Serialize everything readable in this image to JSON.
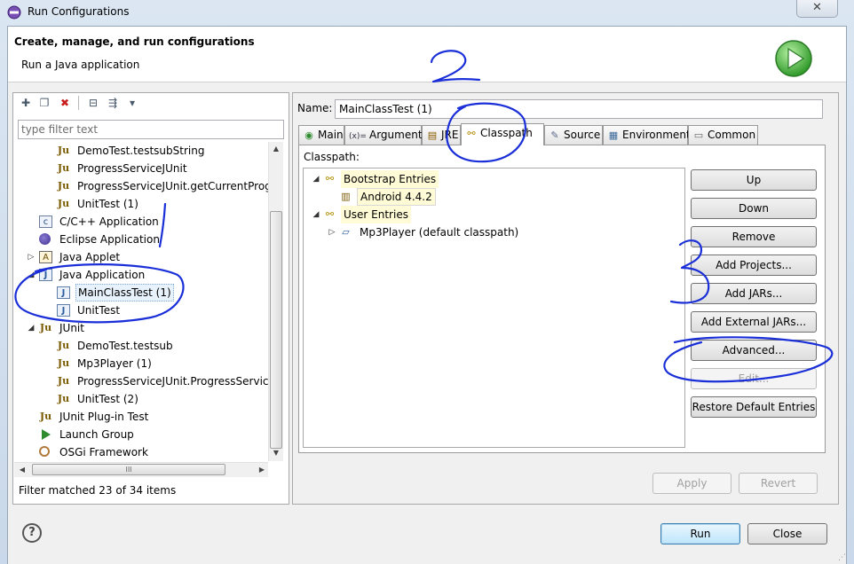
{
  "window": {
    "title": "Run Configurations",
    "close_glyph": "✕",
    "icon": "run-configurations-icon"
  },
  "header": {
    "title": "Create, manage, and run configurations",
    "subtitle": "Run a Java application",
    "icon": "run-play-icon",
    "accent": "#3aa33a"
  },
  "left": {
    "toolbar": [
      {
        "name": "new-configuration-icon",
        "glyph": "✚"
      },
      {
        "name": "duplicate-icon",
        "glyph": "❐"
      },
      {
        "name": "delete-icon",
        "glyph": "✖"
      },
      {
        "name": "collapse-all-icon",
        "glyph": "⊟"
      },
      {
        "name": "filter-icon",
        "glyph": "⇶"
      },
      {
        "name": "view-menu-icon",
        "glyph": "▾"
      }
    ],
    "filter_placeholder": "type filter text",
    "tree": [
      {
        "label": "DemoTest.testsubString",
        "icon": "junit-icon",
        "glyph": "Ju",
        "level": 2
      },
      {
        "label": "ProgressServiceJUnit",
        "icon": "junit-icon",
        "glyph": "Ju",
        "level": 2
      },
      {
        "label": "ProgressServiceJUnit.getCurrentProge",
        "icon": "junit-icon",
        "glyph": "Ju",
        "level": 2
      },
      {
        "label": "UnitTest (1)",
        "icon": "junit-icon",
        "glyph": "Ju",
        "level": 2
      },
      {
        "label": "C/C++ Application",
        "icon": "cpp-application-icon",
        "glyph": "c",
        "level": 1
      },
      {
        "label": "Eclipse Application",
        "icon": "eclipse-application-icon",
        "glyph": "",
        "level": 1
      },
      {
        "label": "Java Applet",
        "icon": "java-applet-icon",
        "glyph": "A",
        "level": 1,
        "twisty": "▷"
      },
      {
        "label": "Java Application",
        "icon": "java-application-icon",
        "glyph": "J",
        "level": 1,
        "twisty": "◢"
      },
      {
        "label": "MainClassTest (1)",
        "icon": "java-application-icon",
        "glyph": "J",
        "level": 2,
        "selected": true
      },
      {
        "label": "UnitTest",
        "icon": "java-application-icon",
        "glyph": "J",
        "level": 2
      },
      {
        "label": "JUnit",
        "icon": "junit-icon",
        "glyph": "Ju",
        "level": 1,
        "twisty": "◢"
      },
      {
        "label": "DemoTest.testsub",
        "icon": "junit-icon",
        "glyph": "Ju",
        "level": 2
      },
      {
        "label": "Mp3Player (1)",
        "icon": "junit-icon",
        "glyph": "Ju",
        "level": 2
      },
      {
        "label": "ProgressServiceJUnit.ProgressServiceJ",
        "icon": "junit-icon",
        "glyph": "Ju",
        "level": 2
      },
      {
        "label": "UnitTest (2)",
        "icon": "junit-icon",
        "glyph": "Ju",
        "level": 2
      },
      {
        "label": "JUnit Plug-in Test",
        "icon": "junit-plugin-icon",
        "glyph": "Ju",
        "level": 1
      },
      {
        "label": "Launch Group",
        "icon": "launch-group-icon",
        "glyph": "",
        "level": 1
      },
      {
        "label": "OSGi Framework",
        "icon": "osgi-framework-icon",
        "glyph": "",
        "level": 1
      }
    ],
    "hscroll_thumb_glyph": "III",
    "status": "Filter matched 23 of 34 items"
  },
  "right": {
    "name_label": "Name:",
    "name_value": "MainClassTest (1)",
    "tabs": [
      {
        "label": "Main",
        "icon": "main-tab-icon",
        "glyph": "◉"
      },
      {
        "label": "Arguments",
        "icon": "arguments-tab-icon",
        "glyph": "(x)="
      },
      {
        "label": "JRE",
        "icon": "jre-tab-icon",
        "glyph": "▤"
      },
      {
        "label": "Classpath",
        "icon": "classpath-tab-icon",
        "glyph": "⚯",
        "active": true
      },
      {
        "label": "Source",
        "icon": "source-tab-icon",
        "glyph": "✎"
      },
      {
        "label": "Environment",
        "icon": "environment-tab-icon",
        "glyph": "▦"
      },
      {
        "label": "Common",
        "icon": "common-tab-icon",
        "glyph": "▭"
      }
    ],
    "classpath_label": "Classpath:",
    "classpath_tree": [
      {
        "label": "Bootstrap Entries",
        "icon": "entries-icon",
        "twisty": "◢",
        "level": 0
      },
      {
        "label": "Android 4.4.2",
        "icon": "library-icon",
        "level": 1
      },
      {
        "label": "User Entries",
        "icon": "entries-icon",
        "twisty": "◢",
        "level": 0
      },
      {
        "label": "Mp3Player (default classpath)",
        "icon": "project-icon",
        "twisty": "▷",
        "level": 1
      }
    ],
    "side_buttons": [
      {
        "label": "Up",
        "enabled": true
      },
      {
        "label": "Down",
        "enabled": true
      },
      {
        "label": "Remove",
        "enabled": true
      },
      {
        "label": "Add Projects...",
        "enabled": true
      },
      {
        "label": "Add JARs...",
        "enabled": true
      },
      {
        "label": "Add External JARs...",
        "enabled": true
      },
      {
        "label": "Advanced...",
        "enabled": true
      },
      {
        "label": "Edit...",
        "enabled": false
      },
      {
        "label": "Restore Default Entries",
        "enabled": true
      }
    ],
    "apply_label": "Apply",
    "revert_label": "Revert"
  },
  "footer": {
    "help_glyph": "?",
    "run_label": "Run",
    "close_label": "Close"
  },
  "annotation_color": "#1a2fd8"
}
